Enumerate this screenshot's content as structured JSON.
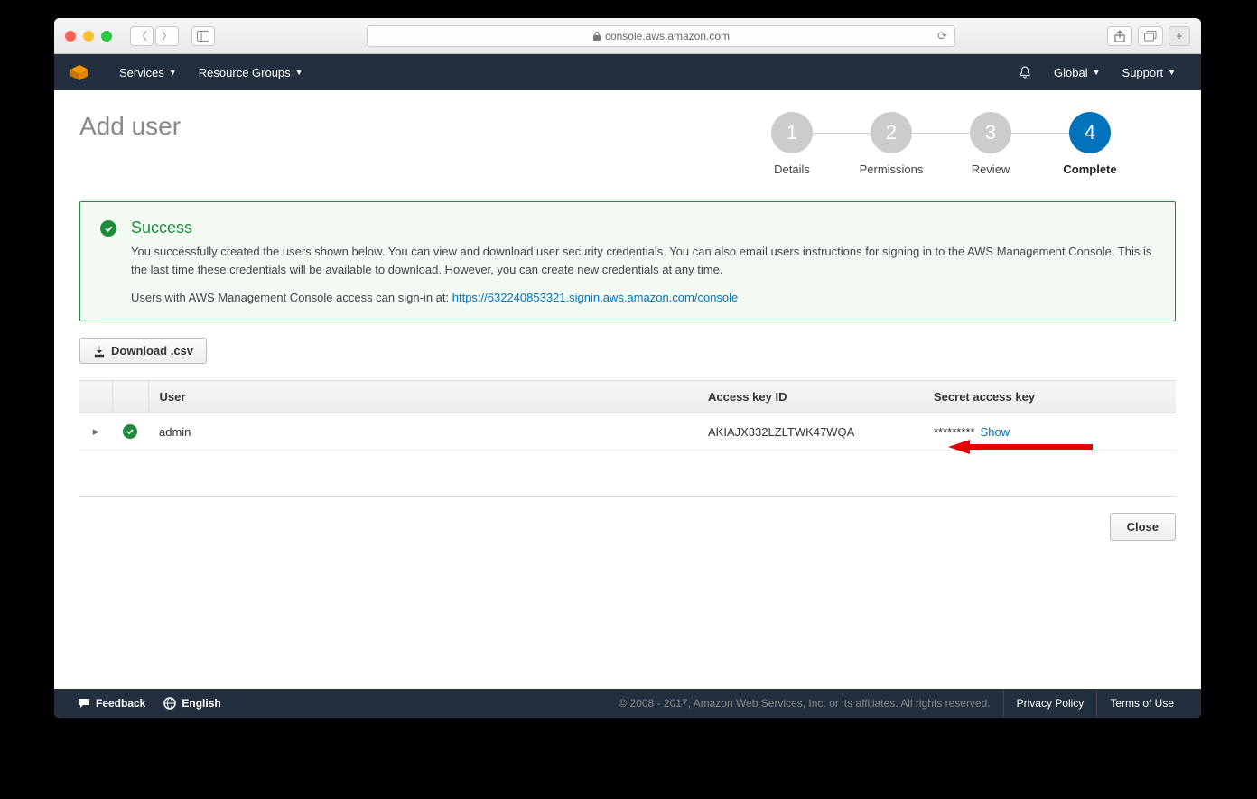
{
  "browser": {
    "url_host": "console.aws.amazon.com"
  },
  "nav": {
    "services": "Services",
    "resource_groups": "Resource Groups",
    "region": "Global",
    "support": "Support"
  },
  "page": {
    "title": "Add user"
  },
  "wizard": {
    "steps": [
      {
        "num": "1",
        "label": "Details"
      },
      {
        "num": "2",
        "label": "Permissions"
      },
      {
        "num": "3",
        "label": "Review"
      },
      {
        "num": "4",
        "label": "Complete"
      }
    ]
  },
  "success": {
    "title": "Success",
    "text": "You successfully created the users shown below. You can view and download user security credentials. You can also email users instructions for signing in to the AWS Management Console. This is the last time these credentials will be available to download. However, you can create new credentials at any time.",
    "signin_prefix": "Users with AWS Management Console access can sign-in at: ",
    "signin_url": "https://632240853321.signin.aws.amazon.com/console"
  },
  "buttons": {
    "download_csv": "Download .csv",
    "close": "Close"
  },
  "table": {
    "headers": {
      "user": "User",
      "access_key": "Access key ID",
      "secret": "Secret access key"
    },
    "rows": [
      {
        "user": "admin",
        "access_key_id": "AKIAJX332LZLTWK47WQA",
        "secret_masked": "*********",
        "show_label": "Show"
      }
    ]
  },
  "footer": {
    "feedback": "Feedback",
    "language": "English",
    "copyright": "© 2008 - 2017, Amazon Web Services, Inc. or its affiliates. All rights reserved.",
    "privacy": "Privacy Policy",
    "terms": "Terms of Use"
  }
}
